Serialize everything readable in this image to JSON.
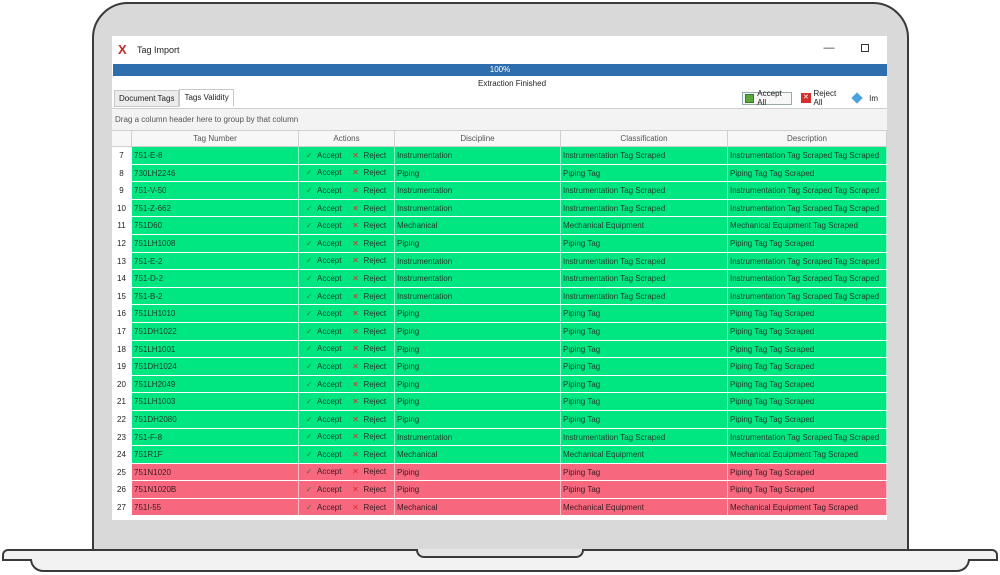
{
  "window": {
    "title": "Tag Import",
    "app_icon_glyph": "X",
    "minimize_glyph": "—"
  },
  "progress": {
    "value": 1.0,
    "label": "100%",
    "status": "Extraction Finished"
  },
  "tabs": [
    {
      "label": "Document Tags",
      "active": false
    },
    {
      "label": "Tags Validity",
      "active": true
    }
  ],
  "toolbar": {
    "accept_all_label": "Accept All",
    "reject_all_label": "Reject All",
    "import_label": "Im"
  },
  "group_hint": "Drag a column header here to group by that column",
  "columns": {
    "tag_number": "Tag Number",
    "actions": "Actions",
    "discipline": "Discipline",
    "classification": "Classification",
    "description": "Description"
  },
  "action_labels": {
    "accept": "Accept",
    "reject": "Reject"
  },
  "colors": {
    "valid_row": "#00e782",
    "invalid_row": "#f7687f",
    "progress": "#2f6eae"
  },
  "rows": [
    {
      "num": "7",
      "tag": "751-E-8",
      "discipline": "Instrumentation",
      "classification": "Instrumentation Tag Scraped",
      "description": "Instrumentation Tag Scraped Tag Scraped",
      "status": "ok"
    },
    {
      "num": "8",
      "tag": "730LH2246",
      "discipline": "Piping",
      "classification": "Piping Tag",
      "description": "Piping Tag Tag Scraped",
      "status": "ok"
    },
    {
      "num": "9",
      "tag": "751-V-50",
      "discipline": "Instrumentation",
      "classification": "Instrumentation Tag Scraped",
      "description": "Instrumentation Tag Scraped Tag Scraped",
      "status": "ok"
    },
    {
      "num": "10",
      "tag": "751-Z-662",
      "discipline": "Instrumentation",
      "classification": "Instrumentation Tag Scraped",
      "description": "Instrumentation Tag Scraped Tag Scraped",
      "status": "ok"
    },
    {
      "num": "11",
      "tag": "751D60",
      "discipline": "Mechanical",
      "classification": "Mechanical Equipment",
      "description": "Mechanical Equipment Tag Scraped",
      "status": "ok"
    },
    {
      "num": "12",
      "tag": "751LH1008",
      "discipline": "Piping",
      "classification": "Piping Tag",
      "description": "Piping Tag Tag Scraped",
      "status": "ok"
    },
    {
      "num": "13",
      "tag": "751-E-2",
      "discipline": "Instrumentation",
      "classification": "Instrumentation Tag Scraped",
      "description": "Instrumentation Tag Scraped Tag Scraped",
      "status": "ok"
    },
    {
      "num": "14",
      "tag": "751-D-2",
      "discipline": "Instrumentation",
      "classification": "Instrumentation Tag Scraped",
      "description": "Instrumentation Tag Scraped Tag Scraped",
      "status": "ok"
    },
    {
      "num": "15",
      "tag": "751-B-2",
      "discipline": "Instrumentation",
      "classification": "Instrumentation Tag Scraped",
      "description": "Instrumentation Tag Scraped Tag Scraped",
      "status": "ok"
    },
    {
      "num": "16",
      "tag": "751LH1010",
      "discipline": "Piping",
      "classification": "Piping Tag",
      "description": "Piping Tag Tag Scraped",
      "status": "ok"
    },
    {
      "num": "17",
      "tag": "751DH1022",
      "discipline": "Piping",
      "classification": "Piping Tag",
      "description": "Piping Tag Tag Scraped",
      "status": "ok"
    },
    {
      "num": "18",
      "tag": "751LH1001",
      "discipline": "Piping",
      "classification": "Piping Tag",
      "description": "Piping Tag Tag Scraped",
      "status": "ok"
    },
    {
      "num": "19",
      "tag": "751DH1024",
      "discipline": "Piping",
      "classification": "Piping Tag",
      "description": "Piping Tag Tag Scraped",
      "status": "ok"
    },
    {
      "num": "20",
      "tag": "751LH2049",
      "discipline": "Piping",
      "classification": "Piping Tag",
      "description": "Piping Tag Tag Scraped",
      "status": "ok"
    },
    {
      "num": "21",
      "tag": "751LH1003",
      "discipline": "Piping",
      "classification": "Piping Tag",
      "description": "Piping Tag Tag Scraped",
      "status": "ok"
    },
    {
      "num": "22",
      "tag": "751DH2080",
      "discipline": "Piping",
      "classification": "Piping Tag",
      "description": "Piping Tag Tag Scraped",
      "status": "ok"
    },
    {
      "num": "23",
      "tag": "751-F-8",
      "discipline": "Instrumentation",
      "classification": "Instrumentation Tag Scraped",
      "description": "Instrumentation Tag Scraped Tag Scraped",
      "status": "ok"
    },
    {
      "num": "24",
      "tag": "751R1F",
      "discipline": "Mechanical",
      "classification": "Mechanical Equipment",
      "description": "Mechanical Equipment Tag Scraped",
      "status": "ok"
    },
    {
      "num": "25",
      "tag": "751N1020",
      "discipline": "Piping",
      "classification": "Piping Tag",
      "description": "Piping Tag Tag Scraped",
      "status": "bad"
    },
    {
      "num": "26",
      "tag": "751N1020B",
      "discipline": "Piping",
      "classification": "Piping Tag",
      "description": "Piping Tag Tag Scraped",
      "status": "bad"
    },
    {
      "num": "27",
      "tag": "751I-55",
      "discipline": "Mechanical",
      "classification": "Mechanical Equipment",
      "description": "Mechanical Equipment Tag Scraped",
      "status": "bad"
    }
  ]
}
